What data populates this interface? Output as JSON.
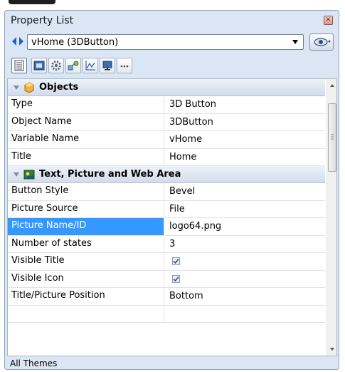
{
  "window": {
    "title": "Property List"
  },
  "object_selector": {
    "value": "vHome (3DButton)"
  },
  "tabs": [
    {
      "icon": "property-list-icon",
      "active": true
    },
    {
      "icon": "form-object-icon",
      "active": false
    },
    {
      "icon": "gear-icon",
      "active": false
    },
    {
      "icon": "shapes-icon",
      "active": false
    },
    {
      "icon": "line-chart-icon",
      "active": false
    },
    {
      "icon": "monitor-icon",
      "active": false
    },
    {
      "icon": "more-icon",
      "active": false
    }
  ],
  "sections": [
    {
      "label": "Objects",
      "props": [
        {
          "name": "Type",
          "value": "3D Button"
        },
        {
          "name": "Object Name",
          "value": "3DButton"
        },
        {
          "name": "Variable Name",
          "value": "vHome"
        },
        {
          "name": "Title",
          "value": "Home"
        }
      ]
    },
    {
      "label": "Text, Picture and Web Area",
      "props": [
        {
          "name": "Button Style",
          "value": "Bevel"
        },
        {
          "name": "Picture Source",
          "value": "File"
        },
        {
          "name": "Picture Name/ID",
          "value": "logo64.png",
          "selected": true
        },
        {
          "name": "Number of states",
          "value": "3"
        },
        {
          "name": "Visible Title",
          "checked": true
        },
        {
          "name": "Visible Icon",
          "checked": true
        },
        {
          "name": "Title/Picture Position",
          "value": "Bottom"
        }
      ]
    }
  ],
  "status": {
    "text": "All Themes"
  },
  "colors": {
    "selection": "#3399ff",
    "section_bg": "#d2dceb",
    "panel_bg": "#dbe6f4"
  }
}
